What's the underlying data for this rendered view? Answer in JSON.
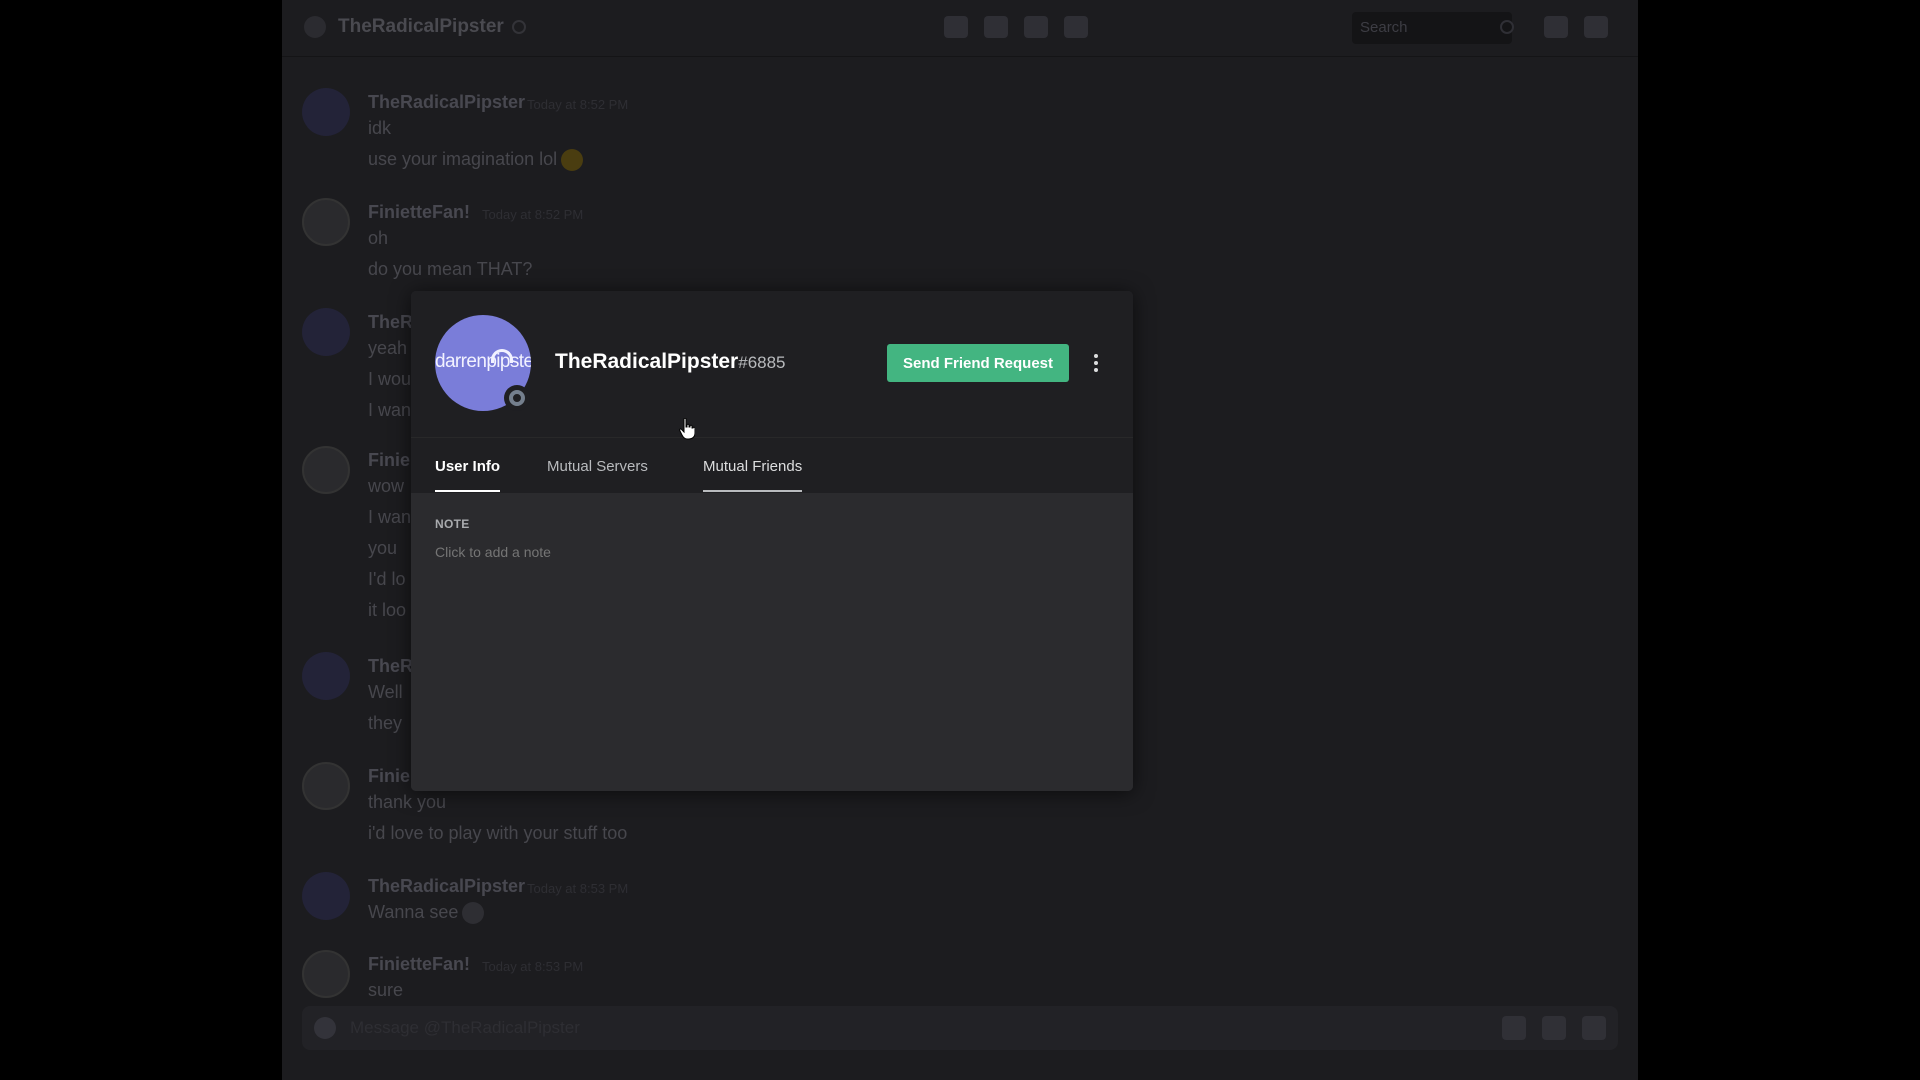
{
  "channel": {
    "title": "TheRadicalPipster",
    "search_placeholder": "Search"
  },
  "messages": [
    {
      "author": "TheRadicalPipster",
      "timestamp": "Today at 8:52 PM",
      "lines": [
        "idk",
        "use your imagination lol"
      ]
    },
    {
      "author": "FinietteFan!",
      "timestamp": "Today at 8:52 PM",
      "lines": [
        "oh",
        "do you mean THAT?"
      ]
    },
    {
      "author": "TheR",
      "timestamp": "",
      "lines": [
        "yeah",
        "I wou",
        "I wan"
      ]
    },
    {
      "author": "Finie",
      "timestamp": "",
      "lines": [
        "wow",
        "I wan",
        "you",
        "I'd lo",
        "it loo"
      ]
    },
    {
      "author": "TheR",
      "timestamp": "",
      "lines": [
        "Well",
        "they"
      ]
    },
    {
      "author": "Finie",
      "timestamp": "",
      "lines": [
        "thank you",
        "i'd love to play with your stuff too"
      ]
    },
    {
      "author": "TheRadicalPipster",
      "timestamp": "Today at 8:53 PM",
      "lines": [
        "Wanna see"
      ]
    },
    {
      "author": "FinietteFan!",
      "timestamp": "Today at 8:53 PM",
      "lines": [
        "sure"
      ]
    }
  ],
  "composer": {
    "placeholder": "Message @TheRadicalPipster"
  },
  "modal": {
    "avatar_text": "darrenpipster",
    "username": "TheRadicalPipster",
    "discriminator": "#6885",
    "send_friend_request_label": "Send Friend Request",
    "tabs": [
      "User Info",
      "Mutual Servers",
      "Mutual Friends"
    ],
    "note_label": "NOTE",
    "note_placeholder": "Click to add a note"
  },
  "colors": {
    "accent_green": "#43b581",
    "avatar_blurple": "#7a7dd9",
    "status_offline": "#747f8d"
  },
  "icons": [
    "call-icon",
    "video-icon",
    "pin-icon",
    "add-member-icon",
    "inbox-icon",
    "help-icon",
    "gift-icon",
    "gif-icon",
    "emoji-icon",
    "more-options-icon",
    "hand-cursor-icon"
  ]
}
